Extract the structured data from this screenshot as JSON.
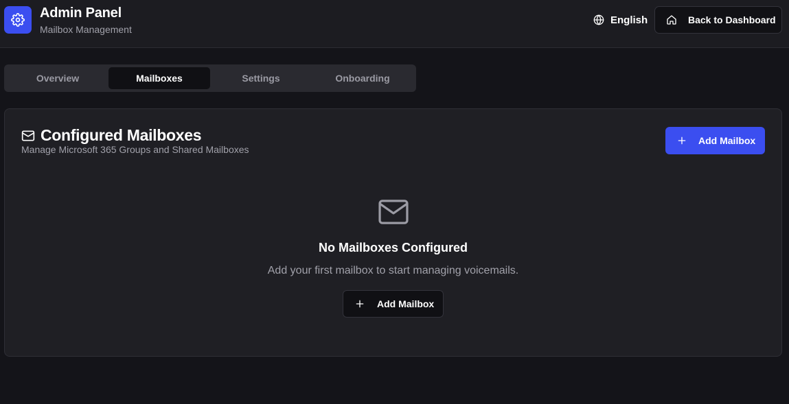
{
  "header": {
    "title": "Admin Panel",
    "subtitle": "Mailbox Management",
    "logo_icon": "gear-icon",
    "language": {
      "label": "English",
      "icon": "globe-icon"
    },
    "back_button": {
      "label": "Back to Dashboard",
      "icon": "home-icon"
    }
  },
  "tabs": [
    {
      "label": "Overview",
      "active": false
    },
    {
      "label": "Mailboxes",
      "active": true
    },
    {
      "label": "Settings",
      "active": false
    },
    {
      "label": "Onboarding",
      "active": false
    }
  ],
  "card": {
    "title": "Configured Mailboxes",
    "title_icon": "mail-icon",
    "subtitle": "Manage Microsoft 365 Groups and Shared Mailboxes",
    "add_button": {
      "label": "Add Mailbox",
      "icon": "plus-icon"
    },
    "empty_state": {
      "icon": "mail-icon",
      "title": "No Mailboxes Configured",
      "description": "Add your first mailbox to start managing voicemails.",
      "button": {
        "label": "Add Mailbox",
        "icon": "plus-icon"
      }
    }
  },
  "colors": {
    "accent": "#3b4ef0",
    "background": "#141419",
    "surface": "#1f1f24",
    "muted_text": "#a1a1aa"
  }
}
